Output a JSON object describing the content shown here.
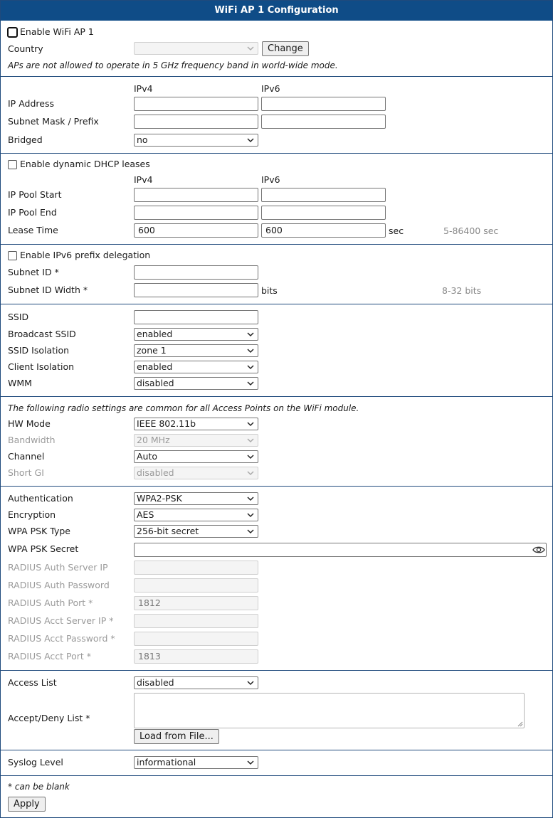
{
  "title": "WiFi AP 1 Configuration",
  "general": {
    "enable_label": "Enable WiFi AP 1",
    "country_label": "Country",
    "country_value": "",
    "change_button": "Change",
    "note": "APs are not allowed to operate in 5 GHz frequency band in world-wide mode."
  },
  "ip": {
    "col_ipv4": "IPv4",
    "col_ipv6": "IPv6",
    "address_label": "IP Address",
    "address_ipv4": "",
    "address_ipv6": "",
    "mask_label": "Subnet Mask / Prefix",
    "mask_ipv4": "",
    "mask_ipv6": "",
    "bridged_label": "Bridged",
    "bridged_value": "no"
  },
  "dhcp": {
    "enable_label": "Enable dynamic DHCP leases",
    "col_ipv4": "IPv4",
    "col_ipv6": "IPv6",
    "pool_start_label": "IP Pool Start",
    "pool_start_ipv4": "",
    "pool_start_ipv6": "",
    "pool_end_label": "IP Pool End",
    "pool_end_ipv4": "",
    "pool_end_ipv6": "",
    "lease_label": "Lease Time",
    "lease_ipv4": "600",
    "lease_ipv6": "600",
    "lease_unit": "sec",
    "lease_hint": "5-86400 sec"
  },
  "prefix": {
    "enable_label": "Enable IPv6 prefix delegation",
    "subnet_id_label": "Subnet ID *",
    "subnet_id_value": "",
    "subnet_width_label": "Subnet ID Width *",
    "subnet_width_value": "",
    "subnet_width_unit": "bits",
    "subnet_width_hint": "8-32 bits"
  },
  "ssid": {
    "ssid_label": "SSID",
    "ssid_value": "",
    "broadcast_label": "Broadcast SSID",
    "broadcast_value": "enabled",
    "isolation_label": "SSID Isolation",
    "isolation_value": "zone 1",
    "client_isolation_label": "Client Isolation",
    "client_isolation_value": "enabled",
    "wmm_label": "WMM",
    "wmm_value": "disabled"
  },
  "radio": {
    "note": "The following radio settings are common for all Access Points on the WiFi module.",
    "hw_mode_label": "HW Mode",
    "hw_mode_value": "IEEE 802.11b",
    "bandwidth_label": "Bandwidth",
    "bandwidth_value": "20 MHz",
    "channel_label": "Channel",
    "channel_value": "Auto",
    "short_gi_label": "Short GI",
    "short_gi_value": "disabled"
  },
  "security": {
    "auth_label": "Authentication",
    "auth_value": "WPA2-PSK",
    "encryption_label": "Encryption",
    "encryption_value": "AES",
    "psk_type_label": "WPA PSK Type",
    "psk_type_value": "256-bit secret",
    "psk_secret_label": "WPA PSK Secret",
    "psk_secret_value": "",
    "radius_auth_ip_label": "RADIUS Auth Server IP",
    "radius_auth_ip_value": "",
    "radius_auth_pw_label": "RADIUS Auth Password",
    "radius_auth_pw_value": "",
    "radius_auth_port_label": "RADIUS Auth Port *",
    "radius_auth_port_value": "1812",
    "radius_acct_ip_label": "RADIUS Acct Server IP *",
    "radius_acct_ip_value": "",
    "radius_acct_pw_label": "RADIUS Acct Password *",
    "radius_acct_pw_value": "",
    "radius_acct_port_label": "RADIUS Acct Port *",
    "radius_acct_port_value": "1813"
  },
  "access": {
    "list_label": "Access List",
    "list_value": "disabled",
    "accept_deny_label": "Accept/Deny List *",
    "accept_deny_value": "",
    "load_button": "Load from File..."
  },
  "syslog": {
    "label": "Syslog Level",
    "value": "informational"
  },
  "footer": {
    "note": "* can be blank",
    "apply_button": "Apply"
  },
  "icons": {
    "caret": "chevron-down-icon",
    "eye": "eye-icon"
  }
}
